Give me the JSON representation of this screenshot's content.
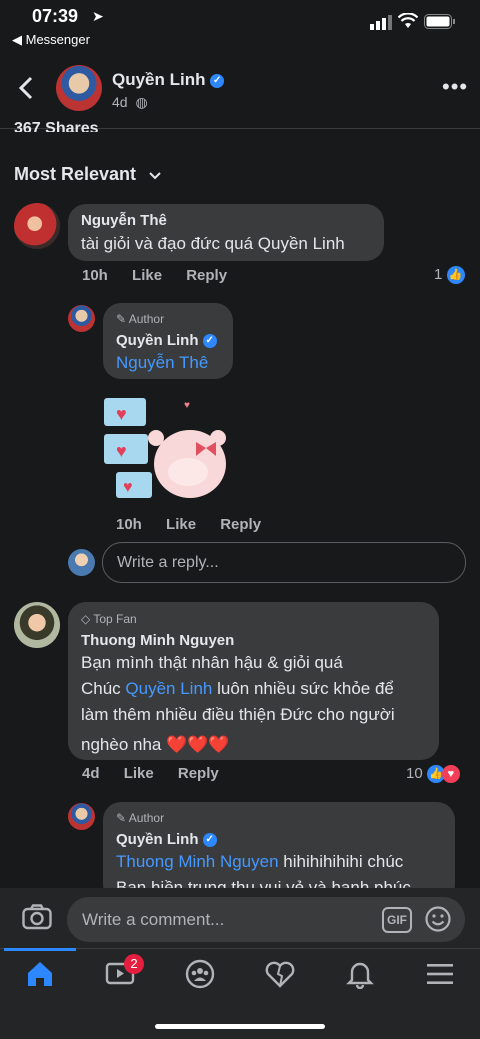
{
  "status": {
    "time": "07:39",
    "back_app": "◀ Messenger"
  },
  "header": {
    "name": "Quyền Linh",
    "time": "4d"
  },
  "post": {
    "shares": "367 Shares"
  },
  "sort": {
    "label": "Most Relevant"
  },
  "comments": [
    {
      "author": "Nguyễn Thê",
      "text": "tài giỏi và đạo đức quá Quyền Linh",
      "time": "10h",
      "like": "Like",
      "reply": "Reply",
      "reactions": "1",
      "replies": [
        {
          "badge": "Author",
          "author": "Quyền Linh",
          "mention": "Nguyễn Thê",
          "time": "10h",
          "like": "Like",
          "reply": "Reply"
        }
      ]
    },
    {
      "badge": "Top Fan",
      "author": "Thuong Minh Nguyen",
      "text_1": "Bạn mình thật nhân hậu & giỏi quá",
      "text_2a": "Chúc ",
      "text_2_mention": "Quyền Linh",
      "text_2b": " luôn nhiều sức khỏe để",
      "text_3": "làm thêm nhiều điều thiện Đức cho người",
      "text_4": "nghèo nha ❤️❤️❤️",
      "time": "4d",
      "like": "Like",
      "reply": "Reply",
      "reactions": "10",
      "replies": [
        {
          "badge": "Author",
          "author": "Quyền Linh",
          "mention": "Thuong Minh Nguyen",
          "text_a": " hihihihihihi chúc",
          "text_b": "Bạn hiền trung thu vui vẻ và hạnh phúc"
        }
      ]
    }
  ],
  "reply_input": {
    "placeholder": "Write a reply..."
  },
  "comment_input": {
    "placeholder": "Write a comment...",
    "gif": "GIF"
  },
  "nav": {
    "video_badge": "2"
  }
}
